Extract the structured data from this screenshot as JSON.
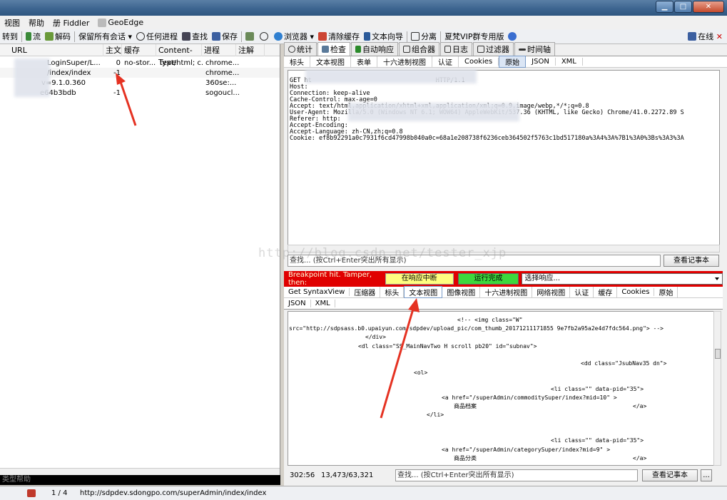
{
  "menu": {
    "items": [
      "视图",
      "帮助",
      "册 Fiddler",
      "GeoEdge"
    ]
  },
  "toolbar": {
    "goto": "转到",
    "stream": "流",
    "decode": "解码",
    "keep": "保留所有会话",
    "any_process": "任何进程",
    "find": "查找",
    "save": "保存",
    "browser": "浏览器",
    "clear_cache": "清除缓存",
    "text_wizard": "文本向导",
    "tearoff": "分离",
    "vip": "夏梵VIP群专用版",
    "online": "在线"
  },
  "sessions": {
    "columns": [
      "URL",
      "主文",
      "缓存",
      "Content-Type",
      "进程",
      "注解"
    ],
    "rows": [
      {
        "url": "LoginSuper/L...",
        "body": "0",
        "cache": "no-stor...",
        "ctype": "text/html; c...",
        "process": "chrome..."
      },
      {
        "url": "/index/index",
        "body": "-1",
        "cache": "",
        "ctype": "",
        "process": "chrome..."
      },
      {
        "url": "v=9.1.0.360",
        "body": "-",
        "cache": "",
        "ctype": "",
        "process": "360se:..."
      },
      {
        "url": "e64b3bdb",
        "body": "-1",
        "cache": "",
        "ctype": "",
        "process": "sogoucl..."
      }
    ],
    "status_text": "类型帮助"
  },
  "inspector": {
    "top_tabs": [
      "统计",
      "检查",
      "自动响应",
      "组合器",
      "日志",
      "过滤器",
      "时间轴"
    ],
    "request_tabs": [
      "标头",
      "文本视图",
      "表单",
      "十六进制视图",
      "认证",
      "Cookies",
      "原始",
      "JSON",
      "XML"
    ],
    "request_lines": [
      "GET ht                                  HTTP/1.1",
      "Host:",
      "Connection: keep-alive",
      "Cache-Control: max-age=0",
      "Accept: text/html,application/xhtml+xml,application/xml;q=0.9,image/webp,*/*;q=0.8",
      "User-Agent: Mozilla/5.0 (Windows NT 6.1; WOW64) AppleWebKit/537.36 (KHTML, like Gecko) Chrome/41.0.2272.89 S",
      "Referer: http:",
      "Accept-Encoding:",
      "Accept-Language: zh-CN,zh;q=0.8",
      "Cookie: ef8b92291a0c7931f6cd47998b040a0c=68a1e208738f6236ceb364502f5763c1bd517180a%3A4%3A%7B1%3A0%3Bs%3A3%3A"
    ],
    "find_placeholder": "查找... (按Ctrl+Enter突出所有显示)",
    "notepad": "查看记事本",
    "breakpoint_label": "Breakpoint hit. Tamper, then:",
    "break_on_response": "在响应中断",
    "run_to_completion": "运行完成",
    "choose_response": "选择响应...",
    "response_tabs": [
      "Get SyntaxView",
      "压缩器",
      "标头",
      "文本视图",
      "图像视图",
      "十六进制视图",
      "网络视图",
      "认证",
      "缓存",
      "Cookies",
      "原始"
    ],
    "response_tabs2": [
      "JSON",
      "XML"
    ],
    "response_lines": [
      "<!-- <img class=\"W\"",
      "src=\"http://sdpsass.b0.upaiyun.com/sdpdev/upload_pic/com_thumb_20171211171855 9e7fb2a95a2e4d7fdc564.png\"> -->",
      "</div>",
      "<dl class=\"SS_MainNavTwo H scroll pb20\" id=\"subnav\">",
      "<dd class=\"JsubNav35 dn\">",
      "<ol>",
      "<li class=\"\" data-pid=\"35\">",
      "<a href=\"/superAdmin/commoditySuper/index?mid=10\" >",
      "商品档案",
      "</a>",
      "</li>",
      "<li class=\"\" data-pid=\"35\">",
      "<a href=\"/superAdmin/categorySuper/index?mid=9\" >",
      "商品分类",
      "</a>",
      "</li>"
    ],
    "cursor_pos": "302:56",
    "size": "13,473/63,321",
    "ellipsis": "..."
  },
  "statusbar": {
    "count": "1 / 4",
    "url": "http://sdpdev.sdongpo.com/superAdmin/index/index"
  },
  "watermark": "http://blog.csdn.net/tester_xjp"
}
